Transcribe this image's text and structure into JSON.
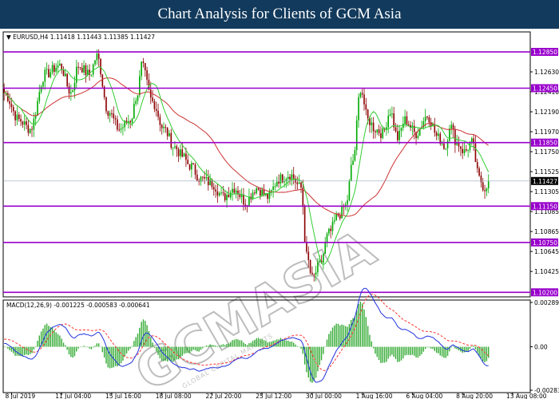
{
  "header": {
    "title": "Chart Analysis for Clients of GCM Asia"
  },
  "watermark": {
    "text": "GCMASIA",
    "subtext": "GLOBAL CAPITAL MARKETS"
  },
  "colors": {
    "header_bg": "#123a5c",
    "level": "#9900cc",
    "bull": "#00aa00",
    "bear": "#8b0000",
    "ma_fast": "#33cc33",
    "ma_slow": "#cc3333",
    "macd_line": "#2233dd",
    "signal_line": "#ff3333",
    "histogram": "#33aa33",
    "current": "#000000"
  },
  "chart_data": [
    {
      "type": "candlestick",
      "title": "EURUSD,H4  1.11418 1.11443 1.11385 1.11427",
      "symbol": "EURUSD",
      "timeframe": "H4",
      "ylim": [
        1.1015,
        1.1307
      ],
      "yticks": [
        1.1263,
        1.1241,
        1.1219,
        1.1197,
        1.1175,
        1.1153,
        1.1131,
        1.1109,
        1.1087,
        1.1065,
        1.1043
      ],
      "ytick_labels": [
        "1.12630",
        "1.12410",
        "1.12190",
        "1.11970",
        "1.11750",
        "1.11525",
        "1.11305",
        "1.11085",
        "1.10865",
        "1.10645",
        "1.10425"
      ],
      "levels": [
        1.1285,
        1.1245,
        1.1185,
        1.1115,
        1.1075,
        1.102
      ],
      "level_labels": [
        "1.12850",
        "1.12450",
        "1.11850",
        "1.11150",
        "1.10750",
        "1.10200"
      ],
      "current_price": 1.11427,
      "current_label": "1.11427",
      "close_anchors": [
        [
          0,
          1.124
        ],
        [
          8,
          1.121
        ],
        [
          14,
          1.12
        ],
        [
          22,
          1.126
        ],
        [
          30,
          1.127
        ],
        [
          36,
          1.124
        ],
        [
          40,
          1.127
        ],
        [
          46,
          1.126
        ],
        [
          50,
          1.128
        ],
        [
          56,
          1.122
        ],
        [
          62,
          1.12
        ],
        [
          68,
          1.121
        ],
        [
          72,
          1.124
        ],
        [
          74,
          1.127
        ],
        [
          80,
          1.123
        ],
        [
          86,
          1.12
        ],
        [
          92,
          1.118
        ],
        [
          96,
          1.117
        ],
        [
          100,
          1.116
        ],
        [
          106,
          1.1145
        ],
        [
          112,
          1.114
        ],
        [
          118,
          1.1125
        ],
        [
          124,
          1.1135
        ],
        [
          130,
          1.112
        ],
        [
          136,
          1.1135
        ],
        [
          142,
          1.1125
        ],
        [
          148,
          1.1145
        ],
        [
          154,
          1.115
        ],
        [
          160,
          1.1135
        ],
        [
          163,
          1.106
        ],
        [
          166,
          1.1035
        ],
        [
          170,
          1.105
        ],
        [
          175,
          1.1085
        ],
        [
          180,
          1.1105
        ],
        [
          184,
          1.1115
        ],
        [
          188,
          1.1165
        ],
        [
          192,
          1.1245
        ],
        [
          196,
          1.121
        ],
        [
          200,
          1.12
        ],
        [
          204,
          1.1195
        ],
        [
          208,
          1.122
        ],
        [
          212,
          1.119
        ],
        [
          216,
          1.121
        ],
        [
          222,
          1.1195
        ],
        [
          228,
          1.1215
        ],
        [
          234,
          1.119
        ],
        [
          238,
          1.118
        ],
        [
          240,
          1.1205
        ],
        [
          244,
          1.1185
        ],
        [
          248,
          1.1175
        ],
        [
          252,
          1.1185
        ],
        [
          256,
          1.1145
        ],
        [
          259,
          1.1135
        ],
        [
          261,
          1.1143
        ]
      ],
      "x_labels": [
        {
          "text": "8 Jul 2019",
          "bar": 4
        },
        {
          "text": "11 Jul 04:00",
          "bar": 31
        },
        {
          "text": "15 Jul 16:00",
          "bar": 58
        },
        {
          "text": "18 Jul 08:00",
          "bar": 85
        },
        {
          "text": "22 Jul 20:00",
          "bar": 112
        },
        {
          "text": "25 Jul 12:00",
          "bar": 139
        },
        {
          "text": "30 Jul 00:00",
          "bar": 166
        },
        {
          "text": "1 Aug 16:00",
          "bar": 193
        },
        {
          "text": "6 Aug 04:00",
          "bar": 220
        },
        {
          "text": "8 Aug 20:00",
          "bar": 247
        },
        {
          "text": "13 Aug 08:00",
          "bar": 274
        }
      ]
    },
    {
      "type": "macd",
      "title": "MACD(12,26,9) -0.001225 -0.000583 -0.000641",
      "params": "12,26,9",
      "values": {
        "macd": -0.001225,
        "signal": -0.000583,
        "histogram": -0.000641
      },
      "ylim": [
        -0.002837,
        0.002897
      ],
      "yticks": [
        0.002897,
        0.0,
        -0.002837
      ],
      "ytick_labels": [
        "0.002897",
        "0.00",
        "-0.002837"
      ]
    }
  ]
}
